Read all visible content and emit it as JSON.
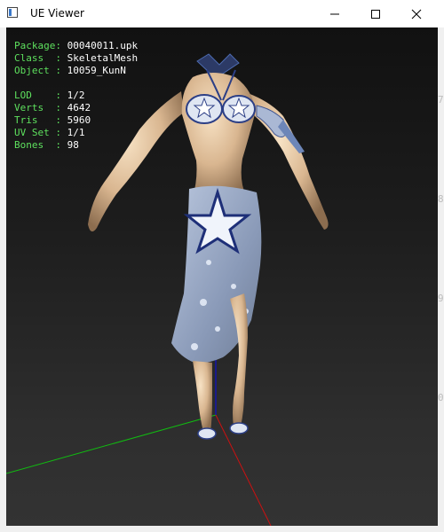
{
  "window": {
    "title": "UE Viewer"
  },
  "info": {
    "package_label": "Package:",
    "package_value": "00040011.upk",
    "class_label": "Class  :",
    "class_value": "SkeletalMesh",
    "object_label": "Object :",
    "object_value": "10059_KunN",
    "lod_label": "LOD    :",
    "lod_value": "1/2",
    "verts_label": "Verts  :",
    "verts_value": "4642",
    "tris_label": "Tris   :",
    "tris_value": "5960",
    "uvset_label": "UV Set :",
    "uvset_value": "1/1",
    "bones_label": "Bones  :",
    "bones_value": "98"
  },
  "background_digits": [
    "7",
    "8",
    "9",
    "0"
  ],
  "colors": {
    "info_label": "#5ee05e",
    "info_value": "#ffffff",
    "axis_x": "#cc1111",
    "axis_y": "#11bb11",
    "axis_z": "#1111cc"
  }
}
